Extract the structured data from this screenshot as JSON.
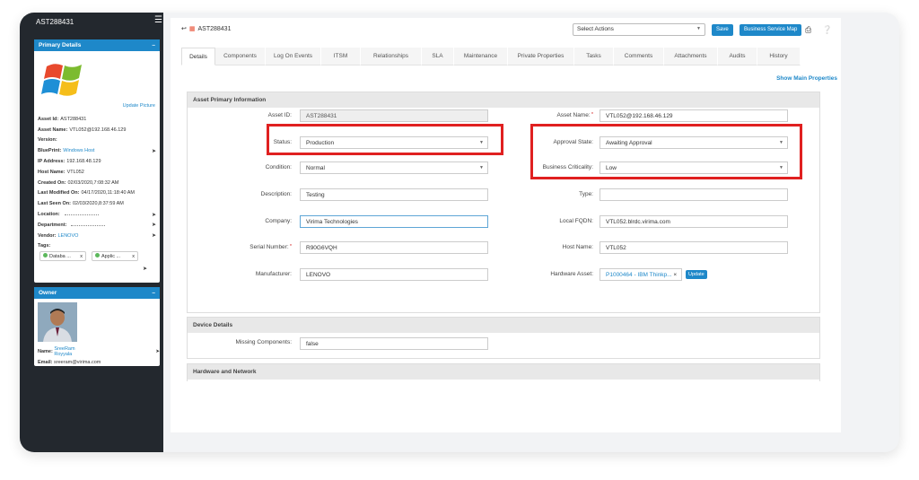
{
  "sidebar": {
    "title": "AST288431",
    "primary": {
      "header": "Primary Details",
      "collapse": "–",
      "update_picture": "Update Picture",
      "rows": [
        {
          "label": "Asset Id:",
          "value": "AST288431",
          "link": false,
          "pin": false
        },
        {
          "label": "Asset Name:",
          "value": "VTL052@192.168.46.129",
          "link": false,
          "pin": false
        },
        {
          "label": "Version:",
          "value": "",
          "link": false,
          "pin": false
        },
        {
          "label": "BluePrint:",
          "value": "Windows Host",
          "link": true,
          "pin": true
        },
        {
          "label": "IP Address:",
          "value": "192.168.48.129",
          "link": false,
          "pin": false
        },
        {
          "label": "Host Name:",
          "value": "VTL052",
          "link": false,
          "pin": false
        },
        {
          "label": "Created On:",
          "value": "02/03/2020,7:08:32 AM",
          "link": false,
          "pin": false
        },
        {
          "label": "Last Modified On:",
          "value": "04/17/2020,11:18:40 AM",
          "link": false,
          "pin": false
        },
        {
          "label": "Last Seen On:",
          "value": "02/03/2020,8:37:59 AM",
          "link": false,
          "pin": false
        },
        {
          "label": "Location:",
          "value": "",
          "link": false,
          "pin": true,
          "dots": true
        },
        {
          "label": "Department:",
          "value": "",
          "link": false,
          "pin": true,
          "dots": true
        },
        {
          "label": "Vendor:",
          "value": "LENOVO",
          "link": true,
          "pin": true
        },
        {
          "label": "Tags:",
          "value": "",
          "link": false,
          "pin": false
        }
      ],
      "tags": [
        "Databa ...",
        "Applic ..."
      ]
    },
    "owner": {
      "header": "Owner",
      "collapse": "–",
      "name_label": "Name:",
      "name": "SreeRam Royyala",
      "email_label": "Email:",
      "email": "sreeram@virima.com"
    }
  },
  "topbar": {
    "asset_id": "AST288431",
    "select_actions": "Select Actions",
    "save": "Save",
    "business_service_map": "Business Service Map"
  },
  "tabs": [
    "Details",
    "Components",
    "Log On Events",
    "ITSM",
    "Relationships",
    "SLA",
    "Maintenance",
    "Private Properties",
    "Tasks",
    "Comments",
    "Attachments",
    "Audits",
    "History"
  ],
  "show_main_properties": "Show Main Properties",
  "asset_primary": {
    "header": "Asset Primary Information",
    "left": [
      {
        "label": "Asset ID:",
        "value": "AST288431"
      },
      {
        "label": "Status:",
        "value": "Production"
      },
      {
        "label": "Condition:",
        "value": "Normal"
      },
      {
        "label": "Description:",
        "value": "Testing"
      },
      {
        "label": "Company:",
        "value": "Virima Technologies"
      },
      {
        "label": "Serial Number:",
        "value": "R90G6VQH"
      },
      {
        "label": "Manufacturer:",
        "value": "LENOVO"
      }
    ],
    "right": [
      {
        "label": "Asset Name:",
        "value": "VTL052@192.168.46.129"
      },
      {
        "label": "Approval State:",
        "value": "Awaiting Approval"
      },
      {
        "label": "Business Criticality:",
        "value": "Low"
      },
      {
        "label": "Type:",
        "value": ""
      },
      {
        "label": "Local FQDN:",
        "value": "VTL052.blrdc.virima.com"
      },
      {
        "label": "Host Name:",
        "value": "VTL052"
      },
      {
        "label": "Hardware Asset:",
        "value": "P1000464 - IBM Thinkp...",
        "update": "Update"
      }
    ]
  },
  "device_details": {
    "header": "Device Details",
    "missing_label": "Missing Components:",
    "missing_value": "false"
  },
  "hardware_network": {
    "header": "Hardware and Network"
  },
  "colors": {
    "accent": "#1e88c9",
    "sidebar": "#23282e",
    "highlight": "#e02020"
  }
}
